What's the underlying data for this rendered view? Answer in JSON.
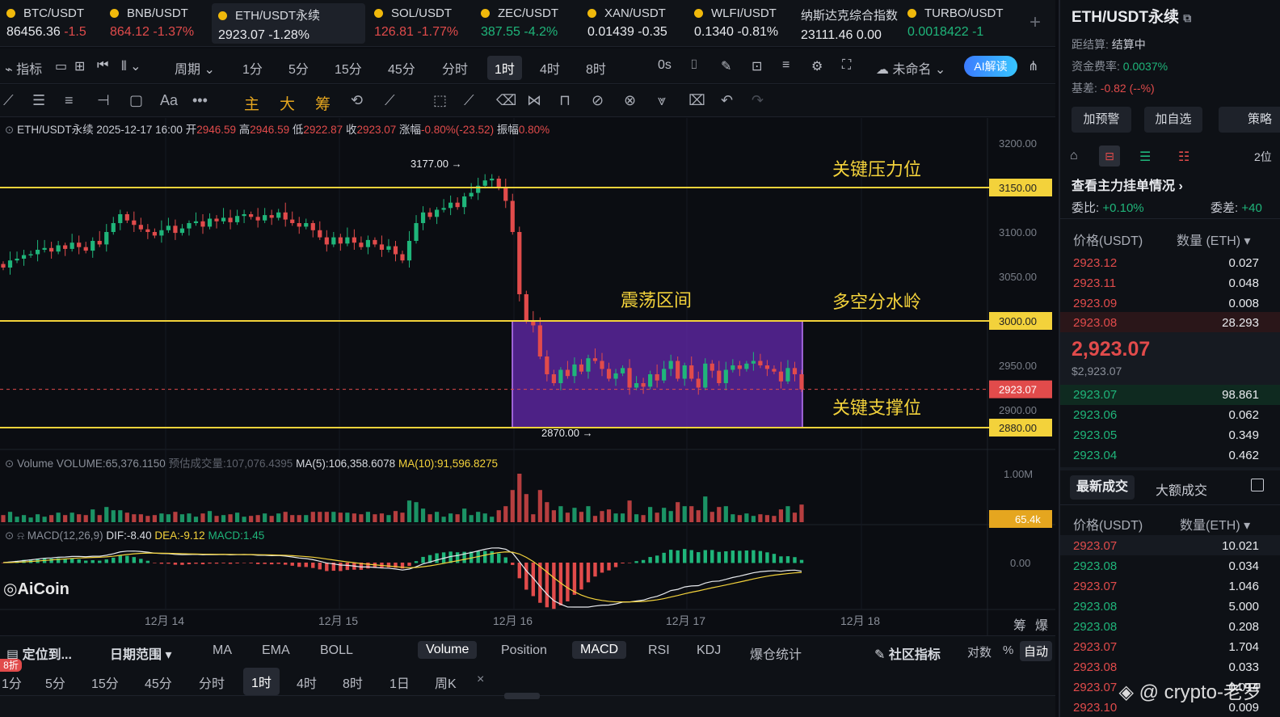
{
  "tickers": [
    {
      "name": "BTC/USDT",
      "price": "86456.36",
      "change": "-1.5",
      "dir": "dn"
    },
    {
      "name": "BNB/USDT",
      "price": "864.12",
      "change": "-1.37%",
      "dir": "dn"
    },
    {
      "name": "ETH/USDT永续",
      "price": "2923.07",
      "change": "-1.28%",
      "dir": "dn"
    },
    {
      "name": "SOL/USDT",
      "price": "126.81",
      "change": "-1.77%",
      "dir": "dn"
    },
    {
      "name": "ZEC/USDT",
      "price": "387.55",
      "change": "-4.2%",
      "dir": "up"
    },
    {
      "name": "XAN/USDT",
      "price": "0.01439",
      "change": "-0.35",
      "dir": "dn"
    },
    {
      "name": "WLFI/USDT",
      "price": "0.1340",
      "change": "-0.81%",
      "dir": "dn"
    },
    {
      "name": "纳斯达克综合指数",
      "price": "23111.46",
      "change": "0.00",
      "dir": "dn"
    },
    {
      "name": "TURBO/USDT",
      "price": "0.0018422",
      "change": "-1",
      "dir": "up"
    }
  ],
  "toolbar": {
    "indicator": "指标",
    "period": "周期",
    "intervals": [
      "1分",
      "5分",
      "15分",
      "45分",
      "分时",
      "1时",
      "4时",
      "8时"
    ],
    "selected": "1时",
    "zero_s": "0s",
    "unnamed": "未命名",
    "ai": "AI解读"
  },
  "drawbar": {
    "main": "主",
    "big": "大",
    "chip": "筹"
  },
  "chart": {
    "info_symbol": "ETH/USDT永续",
    "info_time": "2025-12-17 16:00",
    "info_open_label": "开",
    "info_open": "2946.59",
    "info_high_label": "高",
    "info_high": "2946.59",
    "info_low_label": "低",
    "info_low": "2922.87",
    "info_close_label": "收",
    "info_close": "2923.07",
    "info_chg_label": "涨幅",
    "info_chg": "-0.80%(-23.52)",
    "info_amp_label": "振幅",
    "info_amp": "0.80%",
    "ann_high": "3177.00",
    "ann_low": "2870.00",
    "lbl_resist": "关键压力位",
    "lbl_range": "震荡区间",
    "lbl_pivot": "多空分水岭",
    "lbl_support": "关键支撑位",
    "vol_title": "Volume",
    "vol_value": "VOLUME:65,376.1150",
    "vol_est": "预估成交量:107,076.4395",
    "vol_ma5": "MA(5):106,358.6078",
    "vol_ma10": "MA(10):91,596.8275",
    "macd_title": "MACD(12,26,9)",
    "macd_dif": "DIF:-8.40",
    "macd_dea": "DEA:-9.12",
    "macd_val": "MACD:1.45",
    "logo": "AiCoin",
    "vol_axis": "1.00M",
    "vol_tag": "65.4k",
    "macd_axis": "0.00",
    "chip": "筹",
    "burst": "爆"
  },
  "chart_data": {
    "type": "candlestick",
    "price_axis": [
      "3200.00",
      "3150.00",
      "3100.00",
      "3050.00",
      "3000.00",
      "2950.00",
      "2900.00",
      "2880.00"
    ],
    "levels": [
      {
        "value": 3150,
        "label": "3150.00"
      },
      {
        "value": 3000,
        "label": "3000.00"
      },
      {
        "value": 2880,
        "label": "2880.00"
      }
    ],
    "current_price": "2923.07",
    "dates": [
      "12月 14",
      "12月 15",
      "12月 16",
      "12月 17",
      "12月 18"
    ],
    "range_box": {
      "from_price": 2880,
      "to_price": 3000
    },
    "price_ylim": [
      2860,
      3210
    ],
    "closes": [
      3060,
      3068,
      3070,
      3074,
      3075,
      3080,
      3082,
      3078,
      3085,
      3081,
      3088,
      3083,
      3079,
      3090,
      3086,
      3100,
      3110,
      3120,
      3113,
      3108,
      3103,
      3100,
      3096,
      3102,
      3107,
      3099,
      3104,
      3110,
      3112,
      3106,
      3115,
      3112,
      3116,
      3111,
      3118,
      3120,
      3117,
      3113,
      3119,
      3116,
      3122,
      3114,
      3110,
      3106,
      3110,
      3102,
      3094,
      3086,
      3094,
      3087,
      3094,
      3088,
      3083,
      3091,
      3086,
      3080,
      3084,
      3075,
      3068,
      3090,
      3110,
      3122,
      3117,
      3125,
      3127,
      3133,
      3128,
      3140,
      3144,
      3152,
      3158,
      3160,
      3150,
      3135,
      3100,
      3030,
      3000,
      2995,
      2960,
      2940,
      2930,
      2945,
      2938,
      2951,
      2943,
      2958,
      2955,
      2946,
      2935,
      2941,
      2947,
      2925,
      2930,
      2926,
      2940,
      2933,
      2946,
      2955,
      2935,
      2950,
      2935,
      2925,
      2952,
      2944,
      2930,
      2945,
      2950,
      2946,
      2952,
      2955,
      2950,
      2946,
      2943,
      2932,
      2947,
      2940,
      2923
    ]
  },
  "bottom": {
    "locate": "定位到...",
    "daterange": "日期范围",
    "ind": [
      "MA",
      "EMA",
      "BOLL"
    ],
    "sub": [
      "Volume",
      "Position",
      "MACD",
      "RSI",
      "KDJ",
      "爆仓统计"
    ],
    "community": "社区指标",
    "log": "对数",
    "pct": "%",
    "auto": "自动",
    "intervals": [
      "1分",
      "5分",
      "15分",
      "45分",
      "分时",
      "1时",
      "4时",
      "8时",
      "1日",
      "周K"
    ],
    "sel": "1时",
    "discount": "8折",
    "close": "×"
  },
  "right": {
    "title": "ETH/USDT永续",
    "settle_label": "距结算:",
    "settle": "结算中",
    "funding_label": "资金费率:",
    "funding": "0.0037%",
    "basis_label": "基差:",
    "basis": "-0.82 (--%)",
    "btn_alert": "加预警",
    "btn_fav": "加自选",
    "btn_strategy": "策略",
    "depth_link": "查看主力挂单情况",
    "ratio_label": "委比:",
    "ratio": "+0.10%",
    "diff_label": "委差:",
    "diff": "+40",
    "digits": "2位",
    "col_price": "价格(USDT)",
    "col_qty": "数量 (ETH)",
    "asks": [
      {
        "p": "2923.12",
        "q": "0.027"
      },
      {
        "p": "2923.11",
        "q": "0.048"
      },
      {
        "p": "2923.09",
        "q": "0.008"
      },
      {
        "p": "2923.08",
        "q": "28.293"
      }
    ],
    "last": "2,923.07",
    "last_usd": "$2,923.07",
    "bids": [
      {
        "p": "2923.07",
        "q": "98.861"
      },
      {
        "p": "2923.06",
        "q": "0.062"
      },
      {
        "p": "2923.05",
        "q": "0.349"
      },
      {
        "p": "2923.04",
        "q": "0.462"
      }
    ],
    "tab_latest": "最新成交",
    "tab_big": "大额成交",
    "col_price2": "价格(USDT)",
    "col_qty2": "数量(ETH)",
    "trades": [
      {
        "p": "2923.07",
        "q": "10.021",
        "c": "red"
      },
      {
        "p": "2923.08",
        "q": "0.034",
        "c": "green"
      },
      {
        "p": "2923.07",
        "q": "1.046",
        "c": "red"
      },
      {
        "p": "2923.08",
        "q": "5.000",
        "c": "green"
      },
      {
        "p": "2923.08",
        "q": "0.208",
        "c": "green"
      },
      {
        "p": "2923.07",
        "q": "1.704",
        "c": "red"
      },
      {
        "p": "2923.08",
        "q": "0.033",
        "c": "red"
      },
      {
        "p": "2923.07",
        "q": "0.014",
        "c": "red"
      },
      {
        "p": "2923.10",
        "q": "0.009",
        "c": "red"
      }
    ]
  },
  "watermark": "@ crypto-老罗",
  "colors": {
    "up": "#1fb57a",
    "down": "#e14b4b",
    "level": "#f3d23b",
    "box": "#6a2bb8",
    "box_border": "#c07bff"
  }
}
